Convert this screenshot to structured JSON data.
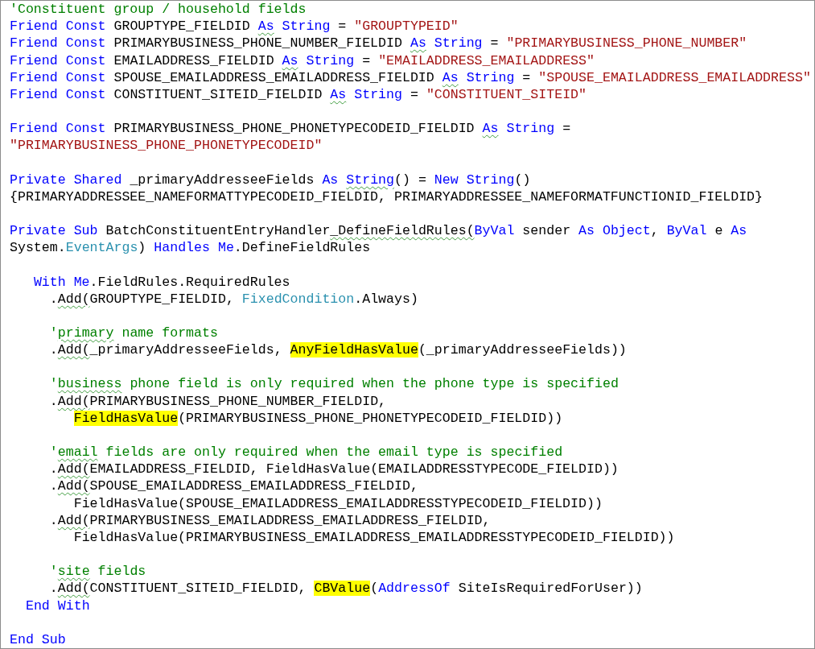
{
  "lines": [
    {
      "kind": "code",
      "tokens": [
        {
          "text": "'Constituent group / household fields",
          "kind": "comment"
        }
      ]
    },
    {
      "kind": "code",
      "tokens": [
        {
          "text": "Friend Const",
          "kind": "keyword"
        },
        {
          "text": " GROUPTYPE_FIELDID ",
          "kind": "plain"
        },
        {
          "text": "As",
          "kind": "keyword",
          "squiggle": true
        },
        {
          "text": " String",
          "kind": "keyword"
        },
        {
          "text": " = ",
          "kind": "plain"
        },
        {
          "text": "\"GROUPTYPEID\"",
          "kind": "string"
        }
      ]
    },
    {
      "kind": "code",
      "tokens": [
        {
          "text": "Friend Const",
          "kind": "keyword"
        },
        {
          "text": " PRIMARYBUSINESS_PHONE_NUMBER_FIELDID ",
          "kind": "plain"
        },
        {
          "text": "As",
          "kind": "keyword",
          "squiggle": true
        },
        {
          "text": " String",
          "kind": "keyword"
        },
        {
          "text": " = ",
          "kind": "plain"
        },
        {
          "text": "\"PRIMARYBUSINESS_PHONE_NUMBER\"",
          "kind": "string"
        }
      ]
    },
    {
      "kind": "code",
      "tokens": [
        {
          "text": "Friend Const",
          "kind": "keyword"
        },
        {
          "text": " EMAILADDRESS_FIELDID ",
          "kind": "plain"
        },
        {
          "text": "As",
          "kind": "keyword",
          "squiggle": true
        },
        {
          "text": " String",
          "kind": "keyword"
        },
        {
          "text": " = ",
          "kind": "plain"
        },
        {
          "text": "\"EMAILADDRESS_EMAILADDRESS\"",
          "kind": "string"
        }
      ]
    },
    {
      "kind": "code",
      "tokens": [
        {
          "text": "Friend Const",
          "kind": "keyword"
        },
        {
          "text": " SPOUSE_EMAILADDRESS_EMAILADDRESS_FIELDID ",
          "kind": "plain"
        },
        {
          "text": "As",
          "kind": "keyword",
          "squiggle": true
        },
        {
          "text": " String",
          "kind": "keyword"
        },
        {
          "text": " = ",
          "kind": "plain"
        },
        {
          "text": "\"SPOUSE_EMAILADDRESS_EMAILADDRESS\"",
          "kind": "string"
        }
      ]
    },
    {
      "kind": "code",
      "tokens": [
        {
          "text": "Friend Const",
          "kind": "keyword"
        },
        {
          "text": " CONSTITUENT_SITEID_FIELDID ",
          "kind": "plain"
        },
        {
          "text": "As",
          "kind": "keyword",
          "squiggle": true
        },
        {
          "text": " String",
          "kind": "keyword"
        },
        {
          "text": " = ",
          "kind": "plain"
        },
        {
          "text": "\"CONSTITUENT_SITEID\"",
          "kind": "string"
        }
      ]
    },
    {
      "kind": "blank"
    },
    {
      "kind": "code",
      "tokens": [
        {
          "text": "Friend Const",
          "kind": "keyword"
        },
        {
          "text": " PRIMARYBUSINESS_PHONE_PHONETYPECODEID_FIELDID ",
          "kind": "plain"
        },
        {
          "text": "As",
          "kind": "keyword",
          "squiggle": true
        },
        {
          "text": " String",
          "kind": "keyword"
        },
        {
          "text": " =",
          "kind": "plain"
        }
      ]
    },
    {
      "kind": "code",
      "tokens": [
        {
          "text": "\"PRIMARYBUSINESS_PHONE_PHONETYPECODEID\"",
          "kind": "string"
        }
      ]
    },
    {
      "kind": "blank"
    },
    {
      "kind": "code",
      "tokens": [
        {
          "text": "Private Shared",
          "kind": "keyword"
        },
        {
          "text": " _primaryAddresseeFields ",
          "kind": "plain"
        },
        {
          "text": "As",
          "kind": "keyword"
        },
        {
          "text": " String",
          "kind": "keyword",
          "squiggle": true
        },
        {
          "text": "() = ",
          "kind": "plain"
        },
        {
          "text": "New String",
          "kind": "keyword"
        },
        {
          "text": "()",
          "kind": "plain"
        }
      ]
    },
    {
      "kind": "code",
      "tokens": [
        {
          "text": "{PRIMARYADDRESSEE_NAMEFORMATTYPECODEID_FIELDID, PRIMARYADDRESSEE_NAMEFORMATFUNCTIONID_FIELDID}",
          "kind": "plain"
        }
      ]
    },
    {
      "kind": "blank"
    },
    {
      "kind": "code",
      "tokens": [
        {
          "text": "Private Sub",
          "kind": "keyword"
        },
        {
          "text": " BatchConstituentEntryHandler",
          "kind": "plain"
        },
        {
          "text": "_DefineFieldRules(",
          "kind": "plain",
          "squiggle": true
        },
        {
          "text": "ByVal",
          "kind": "keyword"
        },
        {
          "text": " sender ",
          "kind": "plain"
        },
        {
          "text": "As Object",
          "kind": "keyword"
        },
        {
          "text": ", ",
          "kind": "plain"
        },
        {
          "text": "ByVal",
          "kind": "keyword"
        },
        {
          "text": " e ",
          "kind": "plain"
        },
        {
          "text": "As",
          "kind": "keyword"
        }
      ]
    },
    {
      "kind": "code",
      "tokens": [
        {
          "text": "System.",
          "kind": "plain"
        },
        {
          "text": "EventArgs",
          "kind": "type"
        },
        {
          "text": ") ",
          "kind": "plain"
        },
        {
          "text": "Handles Me",
          "kind": "keyword"
        },
        {
          "text": ".DefineFieldRules",
          "kind": "plain"
        }
      ]
    },
    {
      "kind": "blank"
    },
    {
      "kind": "code",
      "tokens": [
        {
          "text": "   With Me",
          "kind": "keyword"
        },
        {
          "text": ".FieldRules.RequiredRules",
          "kind": "plain"
        }
      ]
    },
    {
      "kind": "code",
      "tokens": [
        {
          "text": "     .",
          "kind": "plain"
        },
        {
          "text": "Add(",
          "kind": "plain",
          "squiggle": true
        },
        {
          "text": "GROUPTYPE_FIELDID, ",
          "kind": "plain"
        },
        {
          "text": "FixedCondition",
          "kind": "type"
        },
        {
          "text": ".Always)",
          "kind": "plain"
        }
      ]
    },
    {
      "kind": "blank"
    },
    {
      "kind": "code",
      "tokens": [
        {
          "text": "     '",
          "kind": "comment"
        },
        {
          "text": "primary",
          "kind": "comment",
          "squiggle": true
        },
        {
          "text": " name formats",
          "kind": "comment"
        }
      ]
    },
    {
      "kind": "code",
      "tokens": [
        {
          "text": "     .",
          "kind": "plain"
        },
        {
          "text": "Add(",
          "kind": "plain",
          "squiggle": true
        },
        {
          "text": "_primaryAddresseeFields, ",
          "kind": "plain"
        },
        {
          "text": "AnyFieldHasValue",
          "kind": "highlight"
        },
        {
          "text": "(_primaryAddresseeFields))",
          "kind": "plain"
        }
      ]
    },
    {
      "kind": "blank"
    },
    {
      "kind": "code",
      "tokens": [
        {
          "text": "     '",
          "kind": "comment"
        },
        {
          "text": "business",
          "kind": "comment",
          "squiggle": true
        },
        {
          "text": " phone field is only required when the phone type is specified",
          "kind": "comment"
        }
      ]
    },
    {
      "kind": "code",
      "tokens": [
        {
          "text": "     .",
          "kind": "plain"
        },
        {
          "text": "Add(",
          "kind": "plain",
          "squiggle": true
        },
        {
          "text": "PRIMARYBUSINESS_PHONE_NUMBER_FIELDID,",
          "kind": "plain"
        }
      ]
    },
    {
      "kind": "code",
      "tokens": [
        {
          "text": "        FieldHasValue",
          "kind": "highlight"
        },
        {
          "text": "(PRIMARYBUSINESS_PHONE_PHONETYPECODEID_FIELDID))",
          "kind": "plain"
        }
      ]
    },
    {
      "kind": "blank"
    },
    {
      "kind": "code",
      "tokens": [
        {
          "text": "     '",
          "kind": "comment"
        },
        {
          "text": "email",
          "kind": "comment",
          "squiggle": true
        },
        {
          "text": " fields are only required when the email type is specified",
          "kind": "comment"
        }
      ]
    },
    {
      "kind": "code",
      "tokens": [
        {
          "text": "     .",
          "kind": "plain"
        },
        {
          "text": "Add(",
          "kind": "plain",
          "squiggle": true
        },
        {
          "text": "EMAILADDRESS_FIELDID, FieldHasValue(EMAILADDRESSTYPECODE_FIELDID))",
          "kind": "plain"
        }
      ]
    },
    {
      "kind": "code",
      "tokens": [
        {
          "text": "     .",
          "kind": "plain"
        },
        {
          "text": "Add(",
          "kind": "plain",
          "squiggle": true
        },
        {
          "text": "SPOUSE_EMAILADDRESS_EMAILADDRESS_FIELDID,",
          "kind": "plain"
        }
      ]
    },
    {
      "kind": "code",
      "tokens": [
        {
          "text": "        FieldHasValue(SPOUSE_EMAILADDRESS_EMAILADDRESSTYPECODEID_FIELDID))",
          "kind": "plain"
        }
      ]
    },
    {
      "kind": "code",
      "tokens": [
        {
          "text": "     .",
          "kind": "plain"
        },
        {
          "text": "Add(",
          "kind": "plain",
          "squiggle": true
        },
        {
          "text": "PRIMARYBUSINESS_EMAILADDRESS_EMAILADDRESS_FIELDID,",
          "kind": "plain"
        }
      ]
    },
    {
      "kind": "code",
      "tokens": [
        {
          "text": "        FieldHasValue(PRIMARYBUSINESS_EMAILADDRESS_EMAILADDRESSTYPECODEID_FIELDID))",
          "kind": "plain"
        }
      ]
    },
    {
      "kind": "blank"
    },
    {
      "kind": "code",
      "tokens": [
        {
          "text": "     '",
          "kind": "comment"
        },
        {
          "text": "site",
          "kind": "comment",
          "squiggle": true
        },
        {
          "text": " fields",
          "kind": "comment"
        }
      ]
    },
    {
      "kind": "code",
      "tokens": [
        {
          "text": "     .",
          "kind": "plain"
        },
        {
          "text": "Add(",
          "kind": "plain",
          "squiggle": true
        },
        {
          "text": "CONSTITUENT_SITEID_FIELDID, ",
          "kind": "plain"
        },
        {
          "text": "CBValue",
          "kind": "highlight"
        },
        {
          "text": "(",
          "kind": "plain"
        },
        {
          "text": "AddressOf",
          "kind": "keyword"
        },
        {
          "text": " SiteIsRequiredForUser))",
          "kind": "plain"
        }
      ]
    },
    {
      "kind": "code",
      "tokens": [
        {
          "text": "  End With",
          "kind": "keyword"
        }
      ]
    },
    {
      "kind": "blank"
    },
    {
      "kind": "code",
      "tokens": [
        {
          "text": "End Sub",
          "kind": "keyword"
        }
      ]
    }
  ]
}
